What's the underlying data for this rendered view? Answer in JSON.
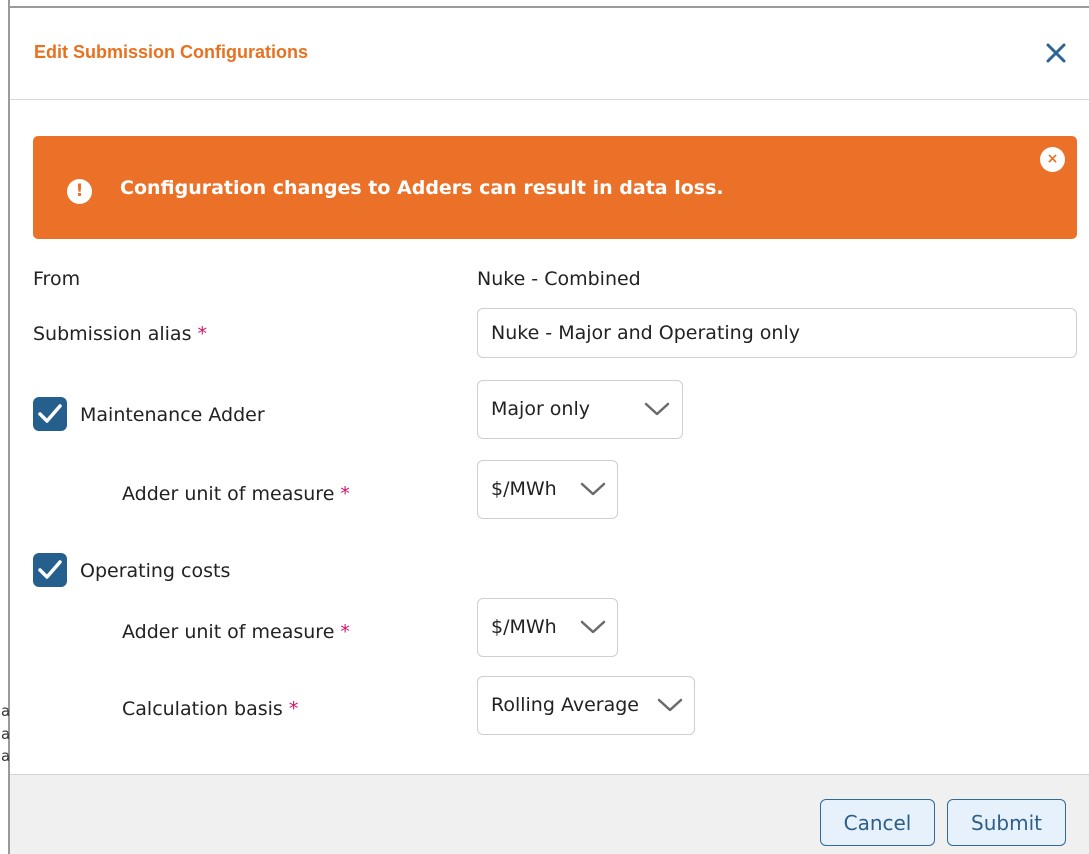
{
  "dialog": {
    "title": "Edit Submission Configurations"
  },
  "alert": {
    "icon": "exclamation-icon",
    "message": "Configuration changes to Adders can result in data loss.",
    "close_icon": "×"
  },
  "form": {
    "from_label": "From",
    "from_value": "Nuke - Combined",
    "alias_label": "Submission alias",
    "alias_value": "Nuke - Major and Operating only",
    "required_marker": "*",
    "maintenance": {
      "checked": true,
      "label": "Maintenance Adder",
      "select_value": "Major only",
      "uom_label": "Adder unit of measure",
      "uom_value": "$/MWh"
    },
    "operating": {
      "checked": true,
      "label": "Operating costs",
      "uom_label": "Adder unit of measure",
      "uom_value": "$/MWh",
      "basis_label": "Calculation basis",
      "basis_value": "Rolling Average"
    }
  },
  "footer": {
    "cancel_label": "Cancel",
    "submit_label": "Submit"
  },
  "colors": {
    "title": "#e8711f",
    "alert_bg": "#ec7128",
    "checkbox": "#245f8e",
    "required": "#d1136b",
    "button_border": "#2f6a99"
  },
  "backdrop": {
    "glyph_1": "a",
    "glyph_2": "a",
    "glyph_3": "a"
  }
}
